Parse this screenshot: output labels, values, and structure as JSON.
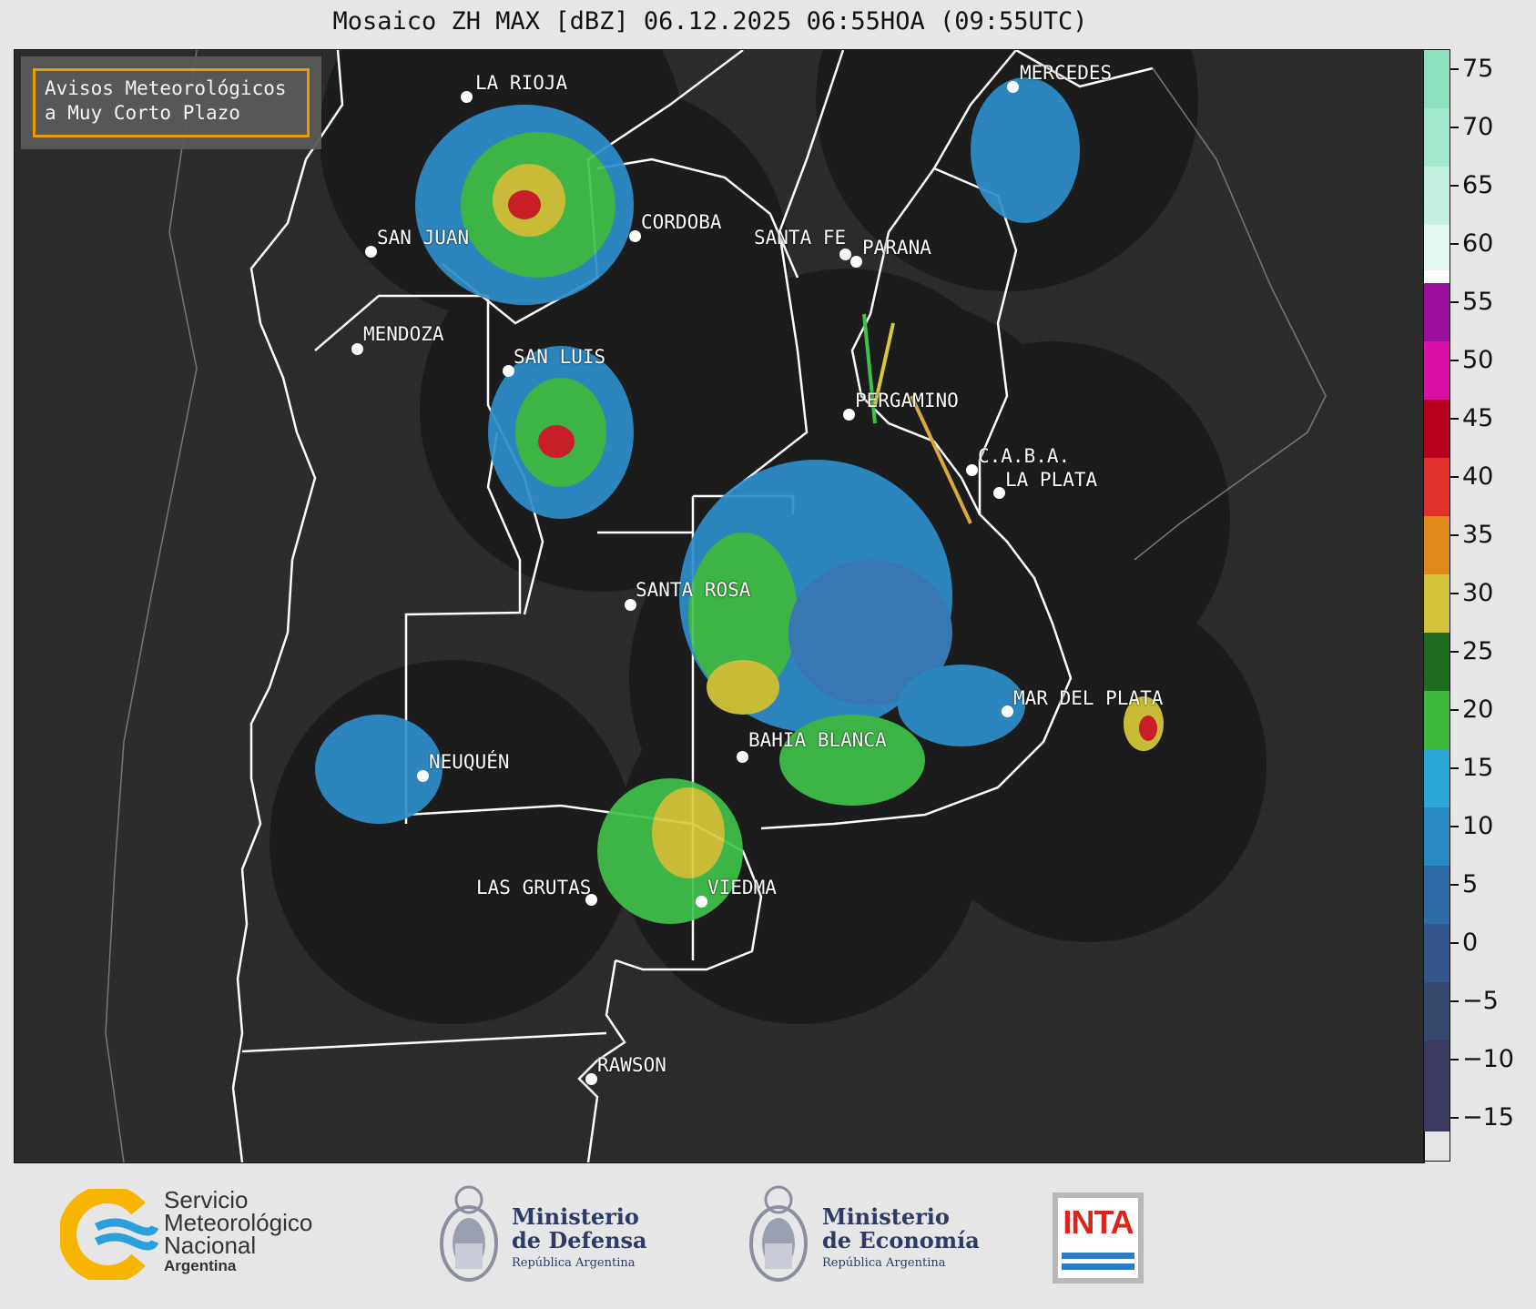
{
  "title": "Mosaico ZH MAX [dBZ] 06.12.2025 06:55HOA (09:55UTC)",
  "badge": {
    "line1": "Avisos Meteorológicos",
    "line2": "a Muy Corto Plazo"
  },
  "colors": {
    "accent": "#f5a300",
    "map_bg": "#2b2b2b",
    "radar_bg": "#1c1c1c",
    "border": "#ffffff"
  },
  "cities": [
    {
      "id": "la-rioja",
      "name": "LA RIOJA"
    },
    {
      "id": "cordoba",
      "name": "CORDOBA"
    },
    {
      "id": "san-juan",
      "name": "SAN JUAN"
    },
    {
      "id": "santa-fe",
      "name": "SANTA FE"
    },
    {
      "id": "parana",
      "name": "PARANA"
    },
    {
      "id": "mendoza",
      "name": "MENDOZA"
    },
    {
      "id": "san-luis",
      "name": "SAN LUIS"
    },
    {
      "id": "pergamino",
      "name": "PERGAMINO"
    },
    {
      "id": "caba",
      "name": "C.A.B.A."
    },
    {
      "id": "la-plata",
      "name": "LA PLATA"
    },
    {
      "id": "santa-rosa",
      "name": "SANTA ROSA"
    },
    {
      "id": "mar-del-plata",
      "name": "MAR DEL PLATA"
    },
    {
      "id": "bahia-blanca",
      "name": "BAHIA BLANCA"
    },
    {
      "id": "neuquen",
      "name": "NEUQUÉN"
    },
    {
      "id": "las-grutas",
      "name": "LAS GRUTAS"
    },
    {
      "id": "viedma",
      "name": "VIEDMA"
    },
    {
      "id": "rawson",
      "name": "RAWSON"
    },
    {
      "id": "mercedes",
      "name": "MERCEDES"
    }
  ],
  "colorbar": {
    "ticks": [
      "75",
      "70",
      "65",
      "60",
      "55",
      "50",
      "45",
      "40",
      "35",
      "30",
      "25",
      "20",
      "15",
      "10",
      "5",
      "0",
      "−5",
      "−10",
      "−15"
    ]
  },
  "logos": {
    "smn": {
      "line1": "Servicio",
      "line2": "Meteorológico",
      "line3": "Nacional",
      "line4": "Argentina"
    },
    "defensa": {
      "line1": "Ministerio",
      "line2": "de Defensa",
      "line3": "República Argentina"
    },
    "economia": {
      "line1": "Ministerio",
      "line2": "de Economía",
      "line3": "República Argentina"
    },
    "inta": {
      "label": "INTA"
    }
  }
}
